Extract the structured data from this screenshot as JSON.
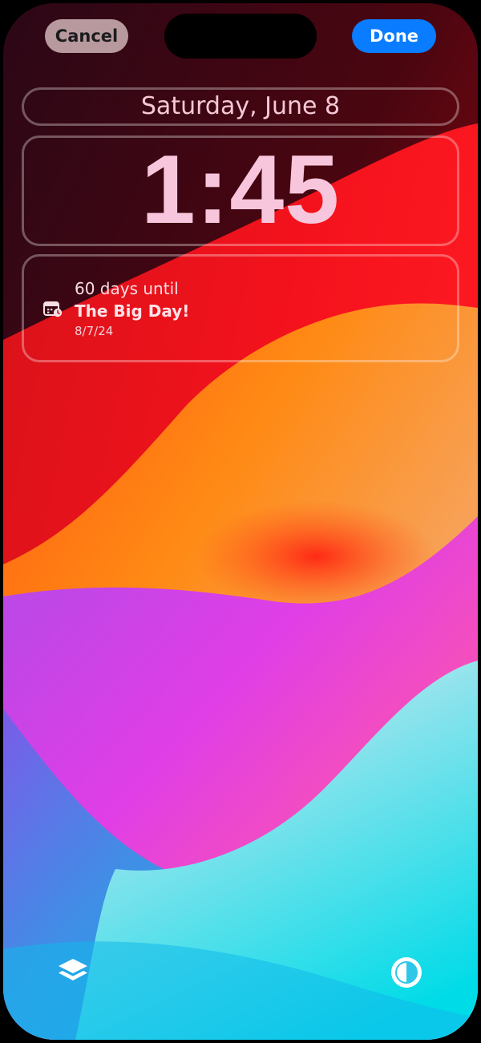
{
  "toolbar": {
    "cancel_label": "Cancel",
    "done_label": "Done"
  },
  "lockscreen": {
    "date": "Saturday, June 8",
    "time": "1:45"
  },
  "widget": {
    "icon": "calendar-clock-icon",
    "line1": "60 days until",
    "title": "The Big Day!",
    "date": "8/7/24"
  },
  "bottom_bar": {
    "left_icon": "layers-icon",
    "right_icon": "contrast-icon"
  },
  "colors": {
    "done_button": "#0a7cff",
    "cancel_button": "#b89a9e",
    "time_text": "#f8c6dc"
  }
}
